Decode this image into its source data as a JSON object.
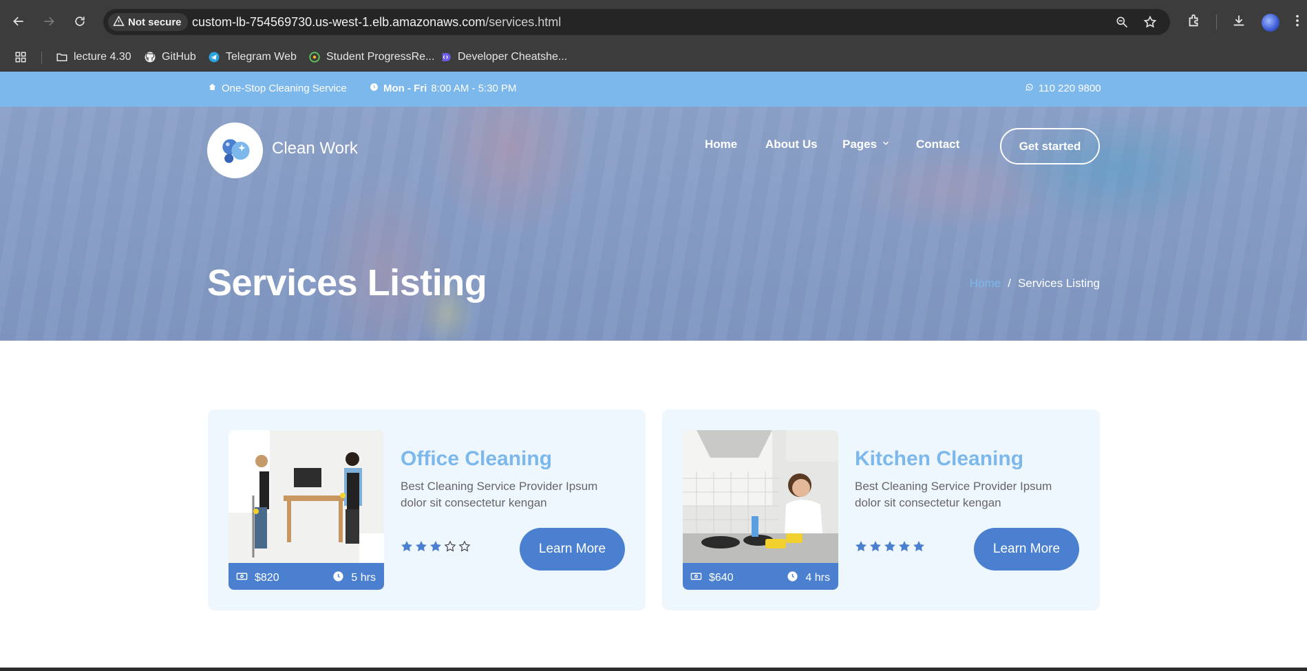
{
  "browser": {
    "security_label": "Not secure",
    "url_host": "custom-lb-754569730.us-west-1.elb.amazonaws.com",
    "url_path": "/services.html",
    "icons": [
      "back-icon",
      "forward-icon",
      "reload-icon",
      "warning-icon",
      "zoom-icon",
      "star-icon",
      "extensions-icon",
      "download-icon",
      "profile-avatar",
      "more-icon"
    ]
  },
  "bookmarks": {
    "items": [
      {
        "label": "lecture 4.30",
        "icon": "folder-icon"
      },
      {
        "label": "GitHub",
        "icon": "github-icon"
      },
      {
        "label": "Telegram Web",
        "icon": "telegram-icon"
      },
      {
        "label": "Student ProgressRe...",
        "icon": "student-progress-icon"
      },
      {
        "label": "Developer Cheatshe...",
        "icon": "devhints-icon"
      }
    ]
  },
  "topbar": {
    "service": "One-Stop Cleaning Service",
    "days": "Mon - Fri",
    "hours": "8:00 AM - 5:30 PM",
    "phone": "110 220 9800"
  },
  "header": {
    "brand": "Clean Work",
    "nav": {
      "home": "Home",
      "about": "About Us",
      "pages": "Pages",
      "contact": "Contact"
    },
    "cta": "Get started"
  },
  "hero": {
    "title": "Services Listing",
    "breadcrumb_home": "Home",
    "breadcrumb_sep": "/",
    "breadcrumb_current": "Services Listing"
  },
  "services": [
    {
      "title": "Office Cleaning",
      "desc": "Best Cleaning Service Provider Ipsum dolor sit consectetur kengan",
      "price": "$820",
      "duration": "5 hrs",
      "rating": 3,
      "rating_max": 5,
      "button": "Learn More"
    },
    {
      "title": "Kitchen Cleaning",
      "desc": "Best Cleaning Service Provider Ipsum dolor sit consectetur kengan",
      "price": "$640",
      "duration": "4 hrs",
      "rating": 5,
      "rating_max": 5,
      "button": "Learn More"
    }
  ],
  "colors": {
    "accent": "#7cb8ec",
    "button": "#4a80cf",
    "star": "#4a80cf",
    "card_bg": "#eef6fe"
  }
}
